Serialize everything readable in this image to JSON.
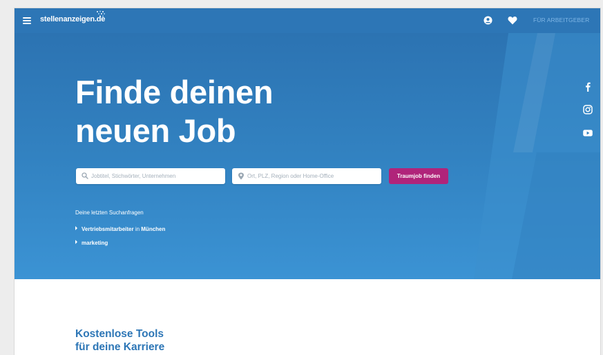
{
  "header": {
    "logo_text": "stellenanzeigen.de",
    "employer_link": "FÜR ARBEITGEBER"
  },
  "hero": {
    "headline_line1": "Finde deinen",
    "headline_line2": "neuen Job",
    "search": {
      "what_placeholder": "Jobtitel, Stichwörter, Unternehmen",
      "what_value": "",
      "where_placeholder": "Ort, PLZ, Region oder Home-Office",
      "where_value": "",
      "button_label": "Traumjob finden"
    },
    "recent": {
      "heading": "Deine letzten Suchanfragen",
      "items": [
        {
          "term": "Vertriebsmitarbeiter",
          "connector": " in ",
          "location": "München"
        },
        {
          "term": "marketing",
          "connector": "",
          "location": ""
        }
      ]
    }
  },
  "social": [
    "facebook-icon",
    "instagram-icon",
    "youtube-icon"
  ],
  "tools": {
    "title_line1": "Kostenlose Tools",
    "title_line2": "für deine Karriere"
  },
  "colors": {
    "brand_blue": "#2d76b6",
    "accent_magenta": "#b0247a",
    "employer_link": "#7fb6e6"
  }
}
